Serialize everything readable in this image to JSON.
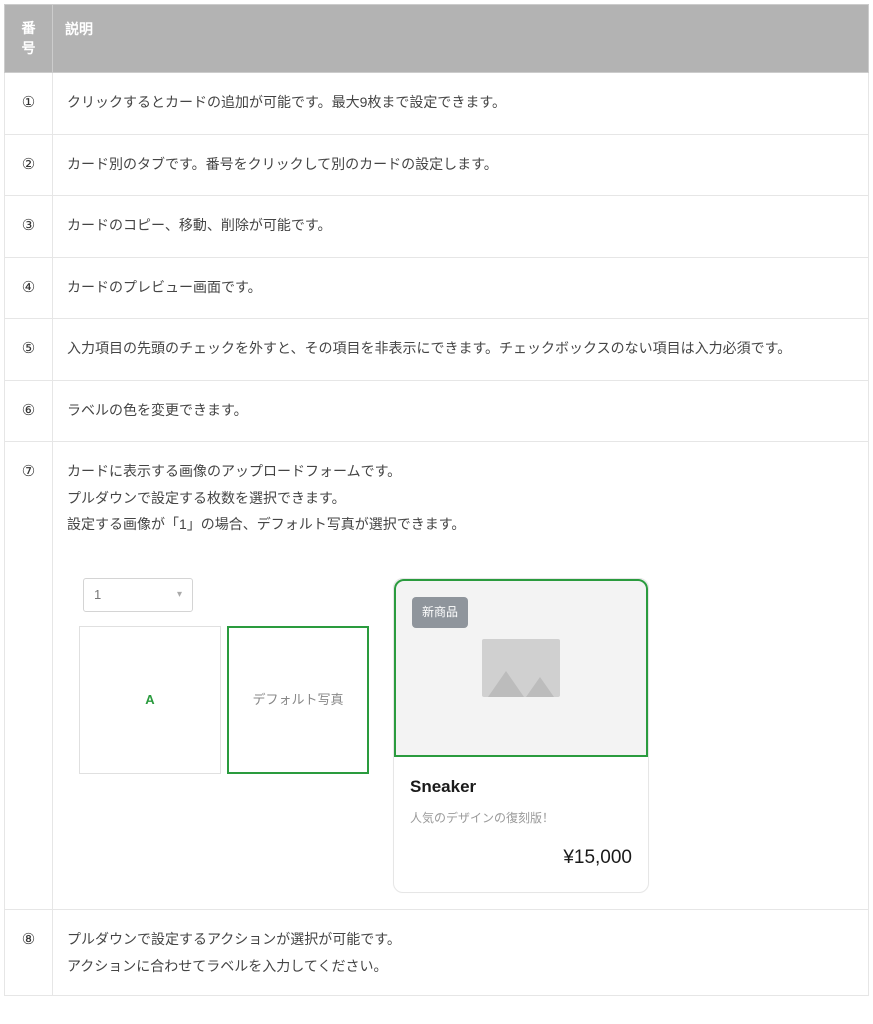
{
  "headers": {
    "number": "番号",
    "description": "説明"
  },
  "rows": [
    {
      "num": "①",
      "desc": [
        "クリックするとカードの追加が可能です。最大9枚まで設定できます。"
      ]
    },
    {
      "num": "②",
      "desc": [
        "カード別のタブです。番号をクリックして別のカードの設定します。"
      ]
    },
    {
      "num": "③",
      "desc": [
        "カードのコピー、移動、削除が可能です。"
      ]
    },
    {
      "num": "④",
      "desc": [
        "カードのプレビュー画面です。"
      ]
    },
    {
      "num": "⑤",
      "desc": [
        "入力項目の先頭のチェックを外すと、その項目を非表示にできます。チェックボックスのない項目は入力必須です。"
      ]
    },
    {
      "num": "⑥",
      "desc": [
        "ラベルの色を変更できます。"
      ]
    },
    {
      "num": "⑦",
      "desc": [
        "カードに表示する画像のアップロードフォームです。",
        "プルダウンで設定する枚数を選択できます。",
        "設定する画像が「1」の場合、デフォルト写真が選択できます。"
      ]
    },
    {
      "num": "⑧",
      "desc": [
        "プルダウンで設定するアクションが選択が可能です。",
        "アクションに合わせてラベルを入力してください。"
      ]
    }
  ],
  "preview": {
    "select_value": "1",
    "thumb_letter": "A",
    "thumb_default_label": "デフォルト写真",
    "card": {
      "badge": "新商品",
      "title": "Sneaker",
      "subtitle": "人気のデザインの復刻版！",
      "price": "¥15,000"
    }
  }
}
